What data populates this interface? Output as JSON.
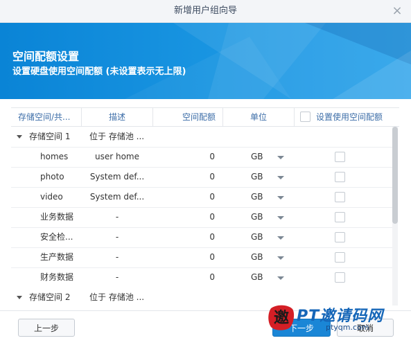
{
  "window": {
    "title": "新增用户组向导",
    "close_glyph": "×"
  },
  "banner": {
    "title": "空间配额设置",
    "subtitle": "设置硬盘使用空间配额 (未设置表示无上限)"
  },
  "table": {
    "headers": {
      "storage": "存储空间/共...",
      "desc": "描述",
      "quota": "空间配额",
      "unit": "单位",
      "enable": "设置使用空间配额"
    },
    "groups": [
      {
        "name": "存储空间 1",
        "desc": "位于 存储池 ...",
        "shares": [
          {
            "name": "homes",
            "desc": "user home",
            "quota": "0",
            "unit": "GB"
          },
          {
            "name": "photo",
            "desc": "System def...",
            "quota": "0",
            "unit": "GB"
          },
          {
            "name": "video",
            "desc": "System def...",
            "quota": "0",
            "unit": "GB"
          },
          {
            "name": "业务数据",
            "desc": "-",
            "quota": "0",
            "unit": "GB"
          },
          {
            "name": "安全检...",
            "desc": "-",
            "quota": "0",
            "unit": "GB"
          },
          {
            "name": "生产数据",
            "desc": "-",
            "quota": "0",
            "unit": "GB"
          },
          {
            "name": "财务数据",
            "desc": "-",
            "quota": "0",
            "unit": "GB"
          }
        ]
      },
      {
        "name": "存储空间 2",
        "desc": "位于 存储池 ..."
      }
    ]
  },
  "footer": {
    "prev": "上一步",
    "next": "下一步",
    "cancel": "取消"
  },
  "watermark": {
    "logo_char": "邀",
    "text": "PT邀请码网",
    "url": "ptyqm.com"
  },
  "colors": {
    "accent": "#1a86d6",
    "header_text": "#3d6ea8",
    "banner": "#0a84d6",
    "watermark": "#1566b8"
  }
}
